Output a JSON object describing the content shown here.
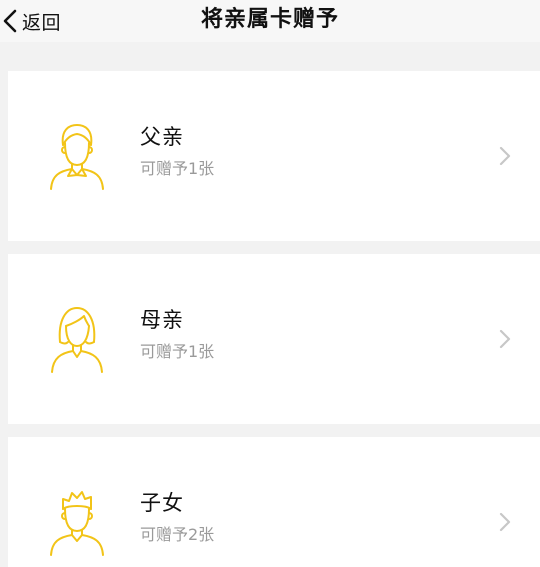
{
  "nav": {
    "back_label": "返回",
    "title": "将亲属卡赠予"
  },
  "recipients": [
    {
      "name": "父亲",
      "subtitle": "可赠予1张",
      "icon": "father-avatar-icon"
    },
    {
      "name": "母亲",
      "subtitle": "可赠予1张",
      "icon": "mother-avatar-icon"
    },
    {
      "name": "子女",
      "subtitle": "可赠予2张",
      "icon": "child-avatar-icon"
    }
  ],
  "colors": {
    "icon_accent": "#f2c418",
    "chevron": "#c7c7c7",
    "subtitle": "#9a9a9a"
  }
}
